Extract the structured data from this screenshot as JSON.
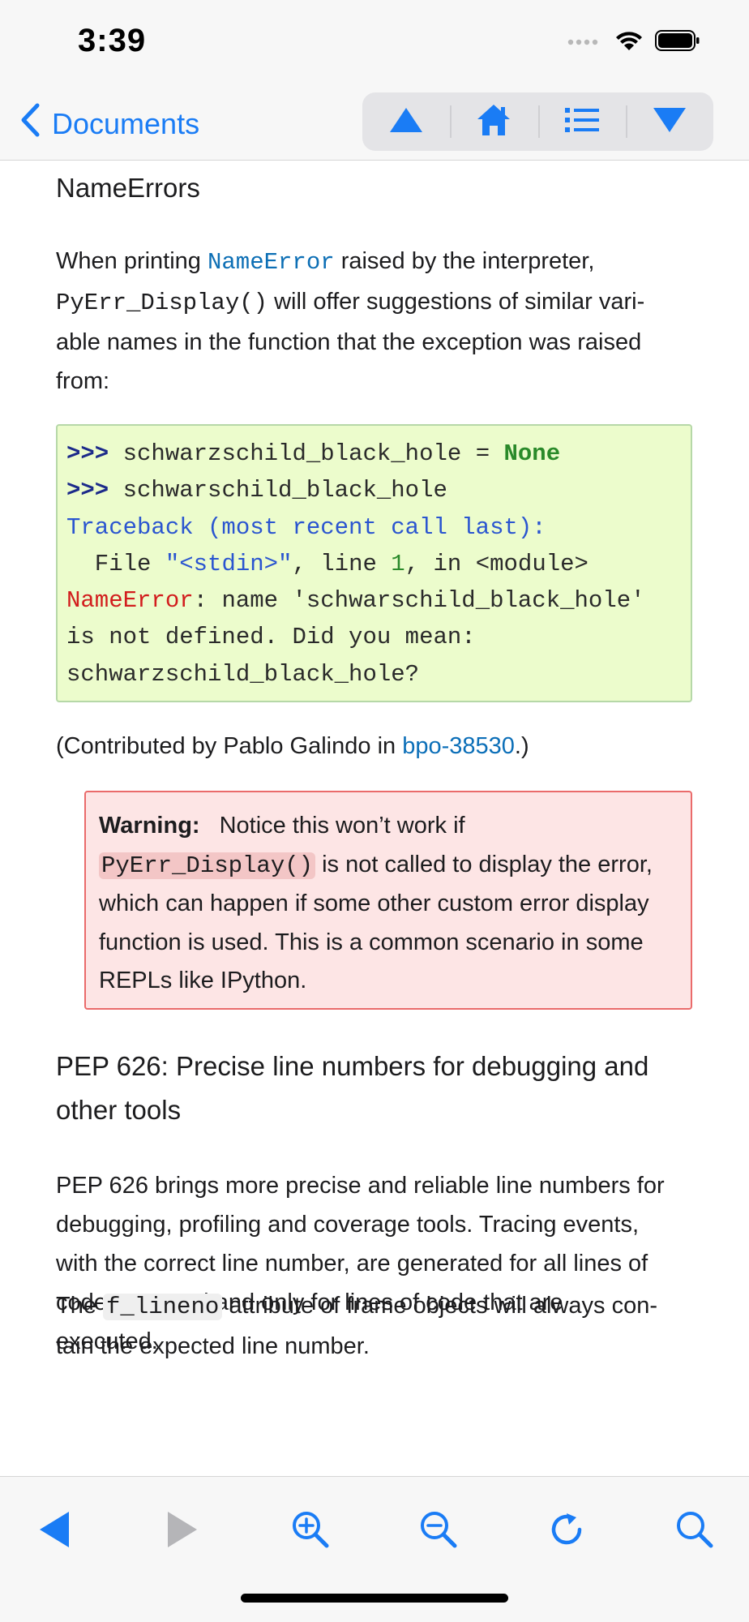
{
  "status": {
    "time": "3:39"
  },
  "nav": {
    "back_label": "Documents"
  },
  "content": {
    "heading_nameerrors": "NameErrors",
    "p1": {
      "t1": "When printing ",
      "c1": "NameError",
      "t2": " raised by the interpreter,",
      "c2": "PyErr_Display()",
      "t3": " will offer suggestions of similar vari-",
      "l3": "able names in the function that the exception was raised",
      "l4": "from:"
    },
    "code": {
      "l1_prompt": ">>>",
      "l1_code": " schwarzschild_black_hole = ",
      "l1_kw": "None",
      "l2_prompt": ">>>",
      "l2_code": " schwarschild_black_hole",
      "l3": "Traceback (most recent call last):",
      "l4_a": "  File ",
      "l4_str": "\"<stdin>\"",
      "l4_b": ", line ",
      "l4_num": "1",
      "l4_c": ", in <module>",
      "l5_err": "NameError",
      "l5_rest": ": name 'schwarschild_black_hole'",
      "l6": "is not defined. Did you mean:",
      "l7": "schwarzschild_black_hole?"
    },
    "contrib": {
      "t1": "(Contributed by Pablo Galindo in ",
      "link": "bpo-38530",
      "t2": ".)"
    },
    "warning": {
      "label": "Warning:",
      "t1": "Notice this won’t work if",
      "code": "PyErr_Display()",
      "t2": " is not called to display the error,",
      "l3": "which can happen if some other custom error display",
      "l4": "function is used. This is a common scenario in some",
      "l5": "REPLs like IPython."
    },
    "heading_pep626": "PEP 626: Precise line numbers for debugging and other tools",
    "p2": {
      "l1": "PEP 626 brings more precise and reliable line numbers for",
      "l2": "debugging, profiling and coverage tools. Tracing events,",
      "l3": "with the correct line number, are generated for all lines of",
      "l4": "code executed and only for lines of code that are",
      "l5": "executed."
    },
    "p3": {
      "t1": "The ",
      "code": "f_lineno",
      "t2": " attribute of frame objects will always con-",
      "l2": "tain the expected line number."
    }
  },
  "colors": {
    "accent": "#1a7cf5",
    "code_bg": "#ecfccc",
    "warning_bg": "#fde5e5",
    "warning_border": "#ea6b6b"
  },
  "icons": {
    "toolbar": [
      "back-triangle-icon",
      "forward-triangle-icon",
      "zoom-in-icon",
      "zoom-out-icon",
      "reload-icon",
      "search-icon"
    ],
    "nav": [
      "previous-up-icon",
      "home-icon",
      "list-icon",
      "next-down-icon"
    ]
  }
}
